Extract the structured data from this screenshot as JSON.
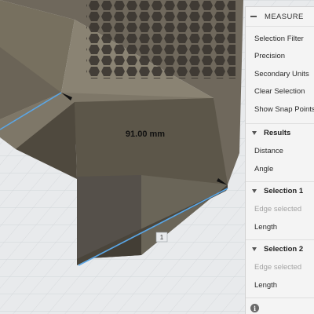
{
  "viewport": {
    "dimension_label": "91.00 mm",
    "edge_marker_label": "1",
    "colors": {
      "background": "#e8eaec",
      "model_body": "#7a7265",
      "model_dark": "#4a4438",
      "selected_edge": "#5aa6e6"
    }
  },
  "panel": {
    "title": "MEASURE",
    "collapse_icon": "minus-icon",
    "options": [
      "Selection Filter",
      "Precision",
      "Secondary Units",
      "Clear Selection",
      "Show Snap Points"
    ],
    "results": {
      "header": "Results",
      "items": [
        "Distance",
        "Angle"
      ]
    },
    "selection1": {
      "header": "Selection 1",
      "status": "Edge selected",
      "item": "Length"
    },
    "selection2": {
      "header": "Selection 2",
      "status": "Edge selected",
      "item": "Length"
    },
    "info_icon": "info-icon"
  }
}
